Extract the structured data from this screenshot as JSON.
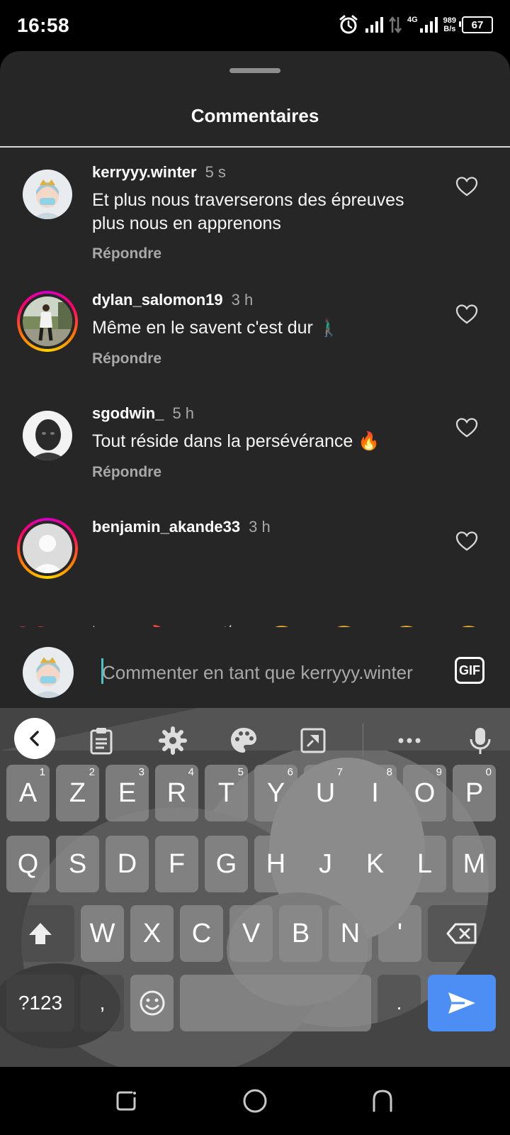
{
  "status_bar": {
    "time": "16:58",
    "network": "4G",
    "speed_value": "989",
    "speed_unit": "B/s",
    "battery": "67"
  },
  "sheet": {
    "title": "Commentaires"
  },
  "comments": [
    {
      "username": "kerryyy.winter",
      "time": "5 s",
      "text": "Et plus nous traverserons des épreuves plus nous en apprenons",
      "reply": "Répondre"
    },
    {
      "username": "dylan_salomon19",
      "time": "3 h",
      "text": "Même en le savent c'est dur 🚶🏿‍♂️",
      "reply": "Répondre"
    },
    {
      "username": "sgodwin_",
      "time": "5 h",
      "text": "Tout réside dans la persévérance 🔥",
      "reply": "Répondre"
    },
    {
      "username": "benjamin_akande33",
      "time": "3 h",
      "text": "",
      "reply": ""
    }
  ],
  "emoji_bar": [
    "❤️",
    "🙌",
    "🔥",
    "👏",
    "😢",
    "😍",
    "😮",
    "😂"
  ],
  "comment_input": {
    "placeholder": "Commenter en tant que kerryyy.winter",
    "gif_label": "GIF"
  },
  "keyboard": {
    "row1": [
      {
        "k": "A",
        "h": "1"
      },
      {
        "k": "Z",
        "h": "2"
      },
      {
        "k": "E",
        "h": "3"
      },
      {
        "k": "R",
        "h": "4"
      },
      {
        "k": "T",
        "h": "5"
      },
      {
        "k": "Y",
        "h": "6"
      },
      {
        "k": "U",
        "h": "7"
      },
      {
        "k": "I",
        "h": "8"
      },
      {
        "k": "O",
        "h": "9"
      },
      {
        "k": "P",
        "h": "0"
      }
    ],
    "row2": [
      "Q",
      "S",
      "D",
      "F",
      "G",
      "H",
      "J",
      "K",
      "L",
      "M"
    ],
    "row3": [
      "W",
      "X",
      "C",
      "V",
      "B",
      "N",
      "'"
    ],
    "symbols_label": "?123",
    "comma": ",",
    "period": "."
  }
}
